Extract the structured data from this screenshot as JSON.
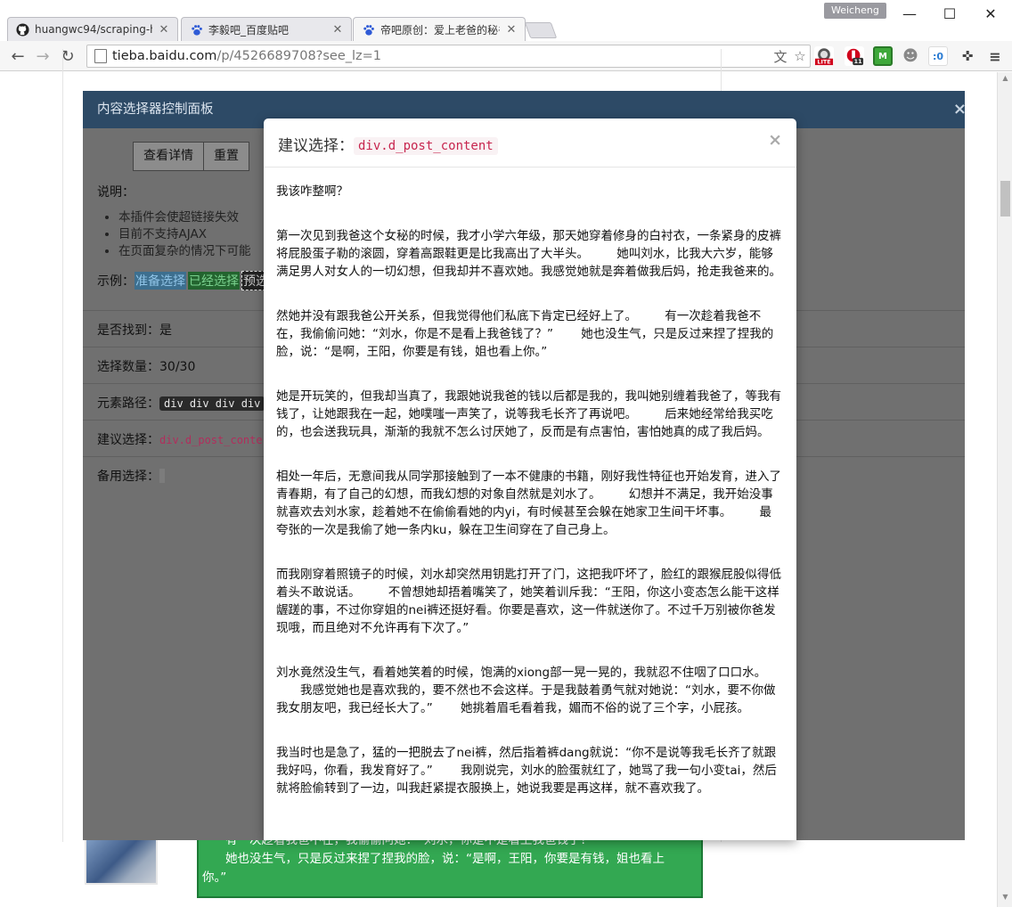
{
  "browser": {
    "tabs": [
      {
        "title": "huangwc94/scraping-help",
        "icon": "github-icon"
      },
      {
        "title": "李毅吧_百度贴吧",
        "icon": "baidu-paw-icon"
      },
      {
        "title": "帝吧原创：爱上老爸的秘书",
        "icon": "baidu-paw-icon"
      }
    ],
    "profile_name": "Weicheng",
    "url_host": "tieba.baidu.com",
    "url_path": "/p/4526689708?see_lz=1",
    "extensions": [
      "translate-icon",
      "star-icon",
      "lite-extension-icon",
      "adblock-extension-icon",
      "m-extension-icon",
      "ghost-extension-icon",
      "counter-extension-icon",
      "puzzle-extension-icon",
      "menu-icon"
    ],
    "counter_badge": "11",
    "counter_text": ":0"
  },
  "panel": {
    "title": "内容选择器控制面板",
    "close": "×",
    "buttons": {
      "detail": "查看详情",
      "reset": "重置"
    },
    "notes_label": "说明：",
    "notes": [
      "本插件会使超链接失效",
      "目前不支持AJAX",
      "在页面复杂的情况下可能"
    ],
    "example_label": "示例：",
    "example_tags": {
      "prepare": "准备选择",
      "selected": "已经选择",
      "preview": "预选"
    },
    "found_label": "是否找到：",
    "found_value": "是",
    "count_label": "选择数量：",
    "count_value": "30/30",
    "path_label": "元素路径：",
    "path_value": "div div div div",
    "suggest_label": "建议选择：",
    "suggest_value": "div.d_post_conte",
    "backup_label": "备用选择："
  },
  "modal": {
    "title": "建议选择：",
    "selector": "div.d_post_content",
    "close": "×",
    "paragraphs": [
      "我该咋整啊？",
      "第一次见到我爸这个女秘的时候，我才小学六年级，那天她穿着修身的白衬衣，一条紧身的皮裤将屁股蛋子勒的滚圆，穿着高跟鞋更是比我高出了大半头。 　　她叫刘水，比我大六岁，能够满足男人对女人的一切幻想，但我却并不喜欢她。我感觉她就是奔着做我后妈，抢走我爸来的。",
      "然她并没有跟我爸公开关系，但我觉得他们私底下肯定已经好上了。 　　有一次趁着我爸不在，我偷偷问她：“刘水，你是不是看上我爸钱了？” 　　她也没生气，只是反过来捏了捏我的脸，说：“是啊，王阳，你要是有钱，姐也看上你。”",
      "她是开玩笑的，但我却当真了，我跟她说我爸的钱以后都是我的，我叫她别缠着我爸了，等我有钱了，让她跟我在一起，她噗嗤一声笑了，说等我毛长齐了再说吧。 　　后来她经常给我买吃的，也会送我玩具，渐渐的我就不怎么讨厌她了，反而是有点害怕，害怕她真的成了我后妈。",
      "相处一年后，无意间我从同学那接触到了一本不健康的书籍，刚好我性特征也开始发育，进入了青春期，有了自己的幻想，而我幻想的对象自然就是刘水了。 　　幻想并不满足，我开始没事就喜欢去刘水家，趁着她不在偷偷看她的内yi，有时候甚至会躲在她家卫生间干坏事。 　　最夸张的一次是我偷了她一条内ku，躲在卫生间穿在了自己身上。",
      "而我刚穿着照镜子的时候，刘水却突然用钥匙打开了门，这把我吓坏了，脸红的跟猴屁股似得低着头不敢说话。 　　不曾想她却捂着嘴笑了，她笑着训斥我：“王阳，你这小变态怎么能干这样龌蹉的事，不过你穿姐的nei裤还挺好看。你要是喜欢，这一件就送你了。不过千万别被你爸发现哦，而且绝对不允许再有下次了。”",
      "刘水竟然没生气，看着她笑着的时候，饱满的xiong部一晃一晃的，我就忍不住咽了口口水。 　　我感觉她也是喜欢我的，要不然也不会这样。于是我鼓着勇气就对她说：“刘水，要不你做我女朋友吧，我已经长大了。” 　　她挑着眉毛看着我，媚而不俗的说了三个字，小屁孩。",
      "我当时也是急了，猛的一把脱去了nei裤，然后指着裤dang就说：“你不是说等我毛长齐了就跟我好吗，你看，我发育好了。” 　　我刚说完，刘水的脸蛋就红了，她骂了我一句小变tai，然后就将脸偷转到了一边，叫我赶紧提衣服换上，她说我要是再这样，就不喜欢我了。"
    ]
  },
  "background_post": {
    "line1": "有一次趁着我爸不在，我偷偷问她：“刘水，你是不是看上我爸钱了？”",
    "line2": "她也没生气，只是反过来捏了捏我的脸，说：“是啊，王阳，你要是有钱，姐也看上",
    "line3": "你。”"
  },
  "colors": {
    "panel_header": "#2d4a66",
    "panel_overlay": "#707070",
    "green_box": "#33a852",
    "selector_red": "#c7254e",
    "tag_prepare": "#5aa9d6",
    "tag_selected": "#2e9e4a"
  }
}
